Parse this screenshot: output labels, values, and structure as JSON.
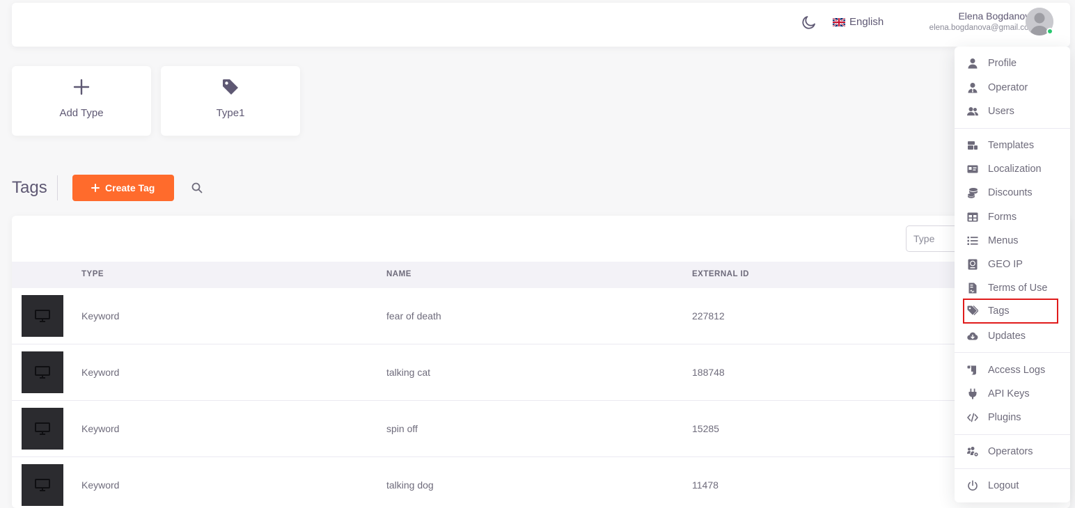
{
  "header": {
    "language": "English",
    "user_name": "Elena Bogdanova",
    "user_email": "elena.bogdanova@gmail.com",
    "status_color": "#28c76f"
  },
  "type_cards": [
    {
      "label": "Add Type",
      "icon": "plus-icon"
    },
    {
      "label": "Type1",
      "icon": "tag-icon"
    }
  ],
  "tags_section": {
    "title": "Tags",
    "create_label": "Create Tag",
    "accent_color": "#ff6b2c"
  },
  "table": {
    "filter_placeholder": "Type",
    "columns": [
      "TYPE",
      "NAME",
      "EXTERNAL ID"
    ],
    "rows": [
      {
        "type": "Keyword",
        "name": "fear of death",
        "external_id": "227812"
      },
      {
        "type": "Keyword",
        "name": "talking cat",
        "external_id": "188748"
      },
      {
        "type": "Keyword",
        "name": "spin off",
        "external_id": "15285"
      },
      {
        "type": "Keyword",
        "name": "talking dog",
        "external_id": "11478"
      }
    ]
  },
  "user_menu": {
    "items": [
      {
        "label": "Profile",
        "icon": "user-icon"
      },
      {
        "label": "Operator",
        "icon": "user-tie-icon"
      },
      {
        "label": "Users",
        "icon": "users-icon"
      },
      {
        "label": "Templates",
        "icon": "templates-icon"
      },
      {
        "label": "Localization",
        "icon": "id-card-icon"
      },
      {
        "label": "Discounts",
        "icon": "coins-icon"
      },
      {
        "label": "Forms",
        "icon": "table-icon"
      },
      {
        "label": "Menus",
        "icon": "list-icon"
      },
      {
        "label": "GEO IP",
        "icon": "passport-icon"
      },
      {
        "label": "Terms of Use",
        "icon": "file-contract-icon"
      },
      {
        "label": "Tags",
        "icon": "tags-icon"
      },
      {
        "label": "Updates",
        "icon": "cloud-download-icon"
      },
      {
        "label": "Access Logs",
        "icon": "scroll-icon"
      },
      {
        "label": "API Keys",
        "icon": "plug-icon"
      },
      {
        "label": "Plugins",
        "icon": "code-icon"
      },
      {
        "label": "Operators",
        "icon": "users-cog-icon"
      },
      {
        "label": "Logout",
        "icon": "power-icon"
      }
    ],
    "highlight_color": "#e01b1b"
  }
}
